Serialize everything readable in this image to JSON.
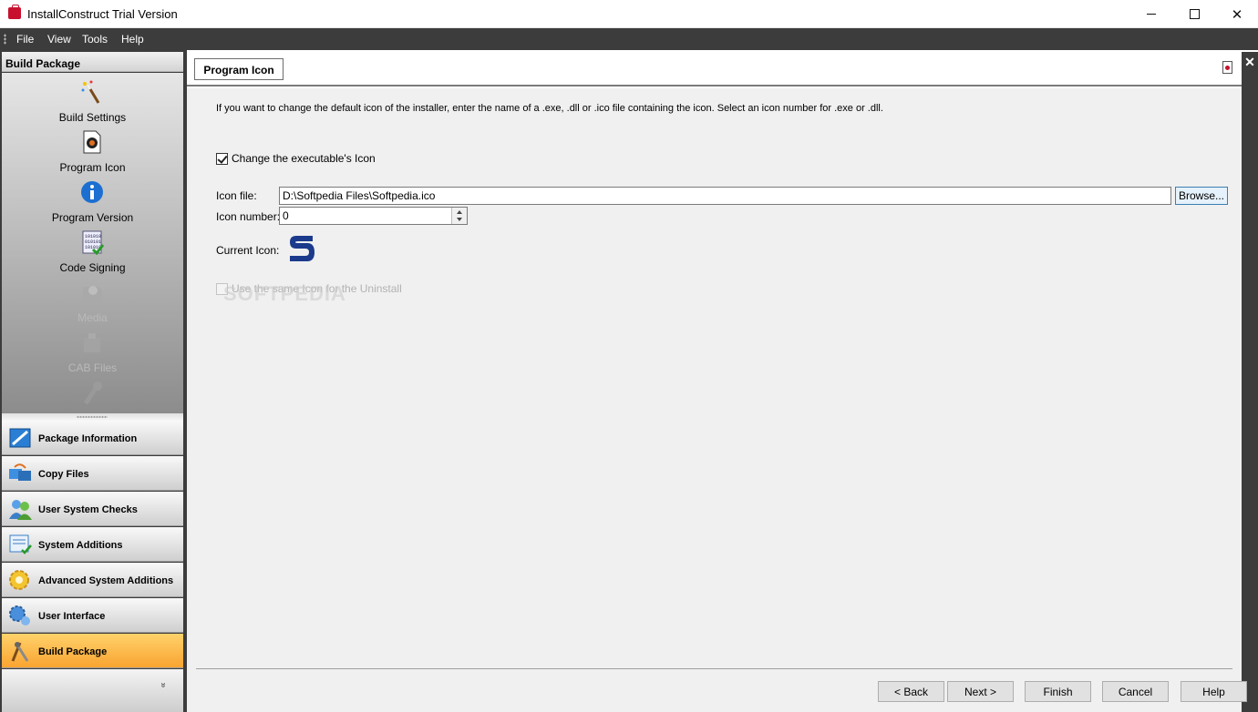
{
  "window": {
    "title": "InstallConstruct Trial Version"
  },
  "menu": {
    "items": [
      "File",
      "View",
      "Tools",
      "Help"
    ]
  },
  "left_pane": {
    "header": "Build Package",
    "tasks": [
      {
        "label": "Build Settings",
        "icon": "magic-wand-icon",
        "enabled": true
      },
      {
        "label": "Program Icon",
        "icon": "program-icon-icon",
        "enabled": true
      },
      {
        "label": "Program Version",
        "icon": "info-icon",
        "enabled": true
      },
      {
        "label": "Code Signing",
        "icon": "code-signing-icon",
        "enabled": true
      },
      {
        "label": "Media",
        "icon": "media-icon",
        "enabled": false
      },
      {
        "label": "CAB Files",
        "icon": "cab-files-icon",
        "enabled": false
      }
    ],
    "nav": [
      {
        "label": "Package Information",
        "icon": "package-information-icon",
        "active": false
      },
      {
        "label": "Copy Files",
        "icon": "copy-files-icon",
        "active": false
      },
      {
        "label": "User System Checks",
        "icon": "users-icon",
        "active": false
      },
      {
        "label": "System Additions",
        "icon": "system-additions-icon",
        "active": false
      },
      {
        "label": "Advanced System Additions",
        "icon": "gears-icon",
        "active": false
      },
      {
        "label": "User Interface",
        "icon": "user-interface-icon",
        "active": false
      },
      {
        "label": "Build Package",
        "icon": "build-tools-icon",
        "active": true
      }
    ],
    "footer_chevron": "»"
  },
  "tab": {
    "label": "Program Icon"
  },
  "content": {
    "intro": "If you want to change the default icon of the installer, enter the name of a .exe, .dll or .ico file containing the icon. Select an icon number for .exe or .dll.",
    "change_icon_checkbox": {
      "label": "Change the executable's Icon",
      "checked": true
    },
    "icon_file": {
      "label": "Icon file:",
      "value": "D:\\Softpedia Files\\Softpedia.ico"
    },
    "browse_label": "Browse...",
    "icon_number": {
      "label": "Icon number:",
      "value": "0"
    },
    "current_icon_label": "Current Icon:",
    "uninstall_checkbox": {
      "label": "Use the same Icon for the Uninstall",
      "checked": false,
      "enabled": false
    },
    "watermark": "SOFTPEDIA"
  },
  "wizard_buttons": {
    "back": "< Back",
    "next": "Next >",
    "finish": "Finish",
    "cancel": "Cancel",
    "help": "Help"
  },
  "colors": {
    "active_nav": "#f9a431",
    "dark_chrome": "#3c3c3c",
    "brand_s": "#1b3a8c"
  }
}
